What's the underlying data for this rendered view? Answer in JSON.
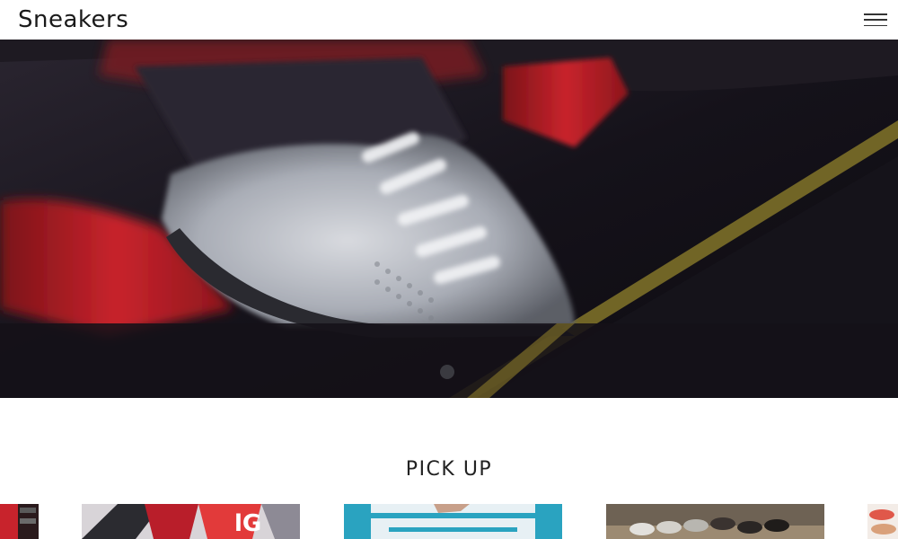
{
  "header": {
    "logo_text": "Sneakers",
    "menu_icon": "hamburger-menu-icon"
  },
  "hero": {
    "image_description_icon": "sneaker-hero-image"
  },
  "pickup": {
    "title": "PICK UP",
    "cards": [
      {
        "icon": "pickup-image-partial-left"
      },
      {
        "icon": "pickup-image-street-sneakers"
      },
      {
        "icon": "pickup-image-skyward-hand"
      },
      {
        "icon": "pickup-image-shoe-collection"
      },
      {
        "icon": "pickup-image-partial-right"
      }
    ]
  },
  "colors": {
    "accent_red": "#c8232c",
    "hero_dark": "#120f16",
    "text": "#222222"
  }
}
